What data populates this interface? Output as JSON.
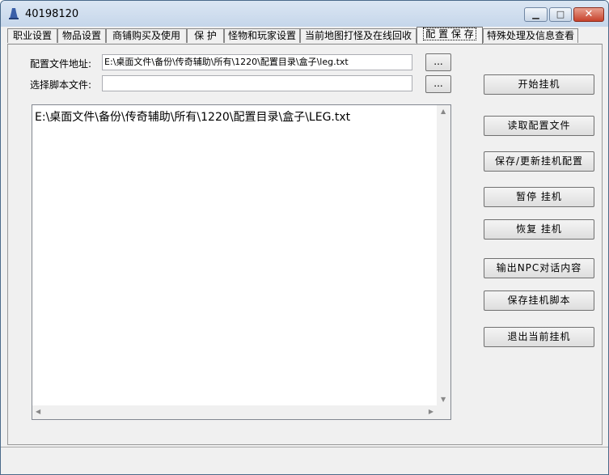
{
  "window": {
    "title": "40198120",
    "minimize_icon": "minimize-icon",
    "maximize_icon": "maximize-icon",
    "close_icon": "close-icon"
  },
  "tabs": [
    {
      "label": "职业设置"
    },
    {
      "label": "物品设置"
    },
    {
      "label": "商铺购买及使用"
    },
    {
      "label": "保  护"
    },
    {
      "label": "怪物和玩家设置"
    },
    {
      "label": "当前地图打怪及在线回收"
    },
    {
      "label": "配 置 保 存",
      "active": true
    },
    {
      "label": "特殊处理及信息查看"
    }
  ],
  "config": {
    "file_label": "配置文件地址:",
    "file_value": "E:\\桌面文件\\备份\\传奇辅助\\所有\\1220\\配置目录\\盒子\\leg.txt",
    "script_label": "选择脚本文件:",
    "script_value": "",
    "browse_label": "..."
  },
  "log": {
    "content": "E:\\桌面文件\\备份\\传奇辅助\\所有\\1220\\配置目录\\盒子\\LEG.txt"
  },
  "actions": {
    "start": "开始挂机",
    "read_config": "读取配置文件",
    "save_update": "保存/更新挂机配置",
    "pause": "暂停 挂机",
    "resume": "恢复 挂机",
    "output_npc": "输出NPC对话内容",
    "save_script": "保存挂机脚本",
    "exit": "退出当前挂机"
  },
  "colors": {
    "app_icon": "#3a5fa8",
    "close_button": "#c7422b"
  }
}
